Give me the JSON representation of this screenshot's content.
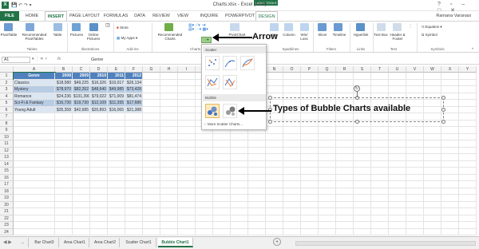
{
  "window": {
    "title": "Charts.xlsx - Excel (Trial)",
    "user": "Ramana Varanasi"
  },
  "tabs": [
    "FILE",
    "HOME",
    "INSERT",
    "PAGE LAYOUT",
    "FORMULAS",
    "DATA",
    "REVIEW",
    "VIEW",
    "INQUIRE",
    "POWERPIVOT",
    "DESIGN"
  ],
  "context_tab": "TABLE TOOLS",
  "ribbon": {
    "buttons": [
      "PivotTable",
      "Recommended PivotTables",
      "Table",
      "Pictures",
      "Online Pictures",
      "Store",
      "My Apps",
      "Recommended Charts",
      "PivotChart",
      "Line",
      "Column",
      "Win/ Loss",
      "Slicer",
      "Timeline",
      "Hyperlink",
      "Text Box",
      "Header & Footer",
      "Equation",
      "Symbol"
    ],
    "groups": [
      "Tables",
      "Illustrations",
      "Add-ins",
      "Charts",
      "Sparklines",
      "Filters",
      "Links",
      "Text",
      "Symbols"
    ]
  },
  "formula_bar": {
    "name_box": "A1",
    "fx": "fx",
    "value": "Genre"
  },
  "columns": [
    "A",
    "B",
    "C",
    "D",
    "E",
    "F",
    "G",
    "H",
    "I",
    "J",
    "K",
    "L",
    "M",
    "N",
    "O",
    "P",
    "Q",
    "R",
    "S",
    "T",
    "U",
    "V",
    "W",
    "X",
    "Y"
  ],
  "table": {
    "headers": [
      "Genre",
      "2008",
      "2009",
      "2010",
      "2011",
      "2012"
    ],
    "rows": [
      [
        "Classics",
        "$18,580",
        "$49,225",
        "$16,326",
        "$10,017",
        "$26,134"
      ],
      [
        "Mystery",
        "$78,970",
        "$82,262",
        "$48,640",
        "$49,985",
        "$73,428"
      ],
      [
        "Romance",
        "$24,236",
        "$131,390",
        "$79,022",
        "$71,009",
        "$81,474"
      ],
      [
        "Sci-Fi & Fantasy",
        "$16,730",
        "$19,730",
        "$12,109",
        "$11,355",
        "$17,686"
      ],
      [
        "Young Adult",
        "$35,358",
        "$42,685",
        "$20,893",
        "$16,065",
        "$21,388"
      ]
    ]
  },
  "gallery": {
    "scatter_label": "Scatter",
    "bubble_label": "Bubble",
    "more_label": "More Scatter Charts..."
  },
  "annotations": {
    "arrow": "Arrow",
    "bubble_types": "Types of Bubble Charts available"
  },
  "sheet_tabs": [
    "...",
    "Bar Chart3",
    "Area Chart1",
    "Area Chart2",
    "Scatter Chart1",
    "Bubble Chart1"
  ],
  "colors": {
    "excel_green": "#217346",
    "table_header": "#4f81bd",
    "row_band": "#dce6f1"
  }
}
